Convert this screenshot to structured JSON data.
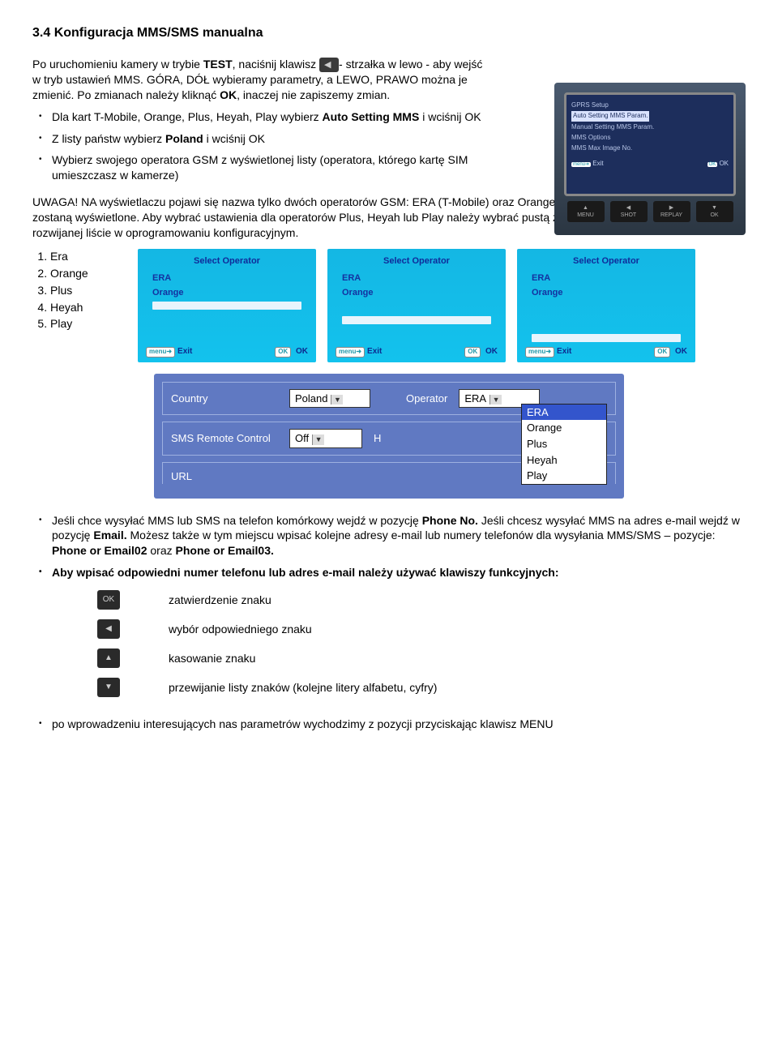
{
  "heading": "3.4 Konfiguracja MMS/SMS manualna",
  "para1_a": "Po uruchomieniu kamery w trybie ",
  "para1_test": "TEST",
  "para1_b": ", naciśnij klawisz ",
  "para1_c": "- strzałka w lewo - aby wejść w tryb ustawień MMS. GÓRA, DÓŁ wybieramy parametry, a LEWO, PRAWO można je zmienić. Po zmianach należy kliknąć ",
  "para1_ok": "OK",
  "para1_d": ", inaczej nie zapiszemy zmian.",
  "bullets1": {
    "b1a": "Dla kart T-Mobile, Orange, Plus, Heyah, Play wybierz ",
    "b1b": "Auto Setting MMS",
    "b1c": " i wciśnij OK",
    "b2a": "Z listy państw wybierz ",
    "b2b": "Poland",
    "b2c": " i wciśnij OK",
    "b3": "Wybierz swojego operatora GSM z wyświetlonej listy (operatora, którego kartę SIM umieszczasz w kamerze)"
  },
  "device": {
    "l1": "GPRS Setup",
    "l2": "Auto Setting MMS Param.",
    "l3": "Manual Setting MMS Param.",
    "l4": "MMS Options",
    "l5": "MMS Max Image No.",
    "exit_badge": "menu➜",
    "exit": "Exit",
    "ok_badge": "OK",
    "ok": "OK",
    "btn1": "MENU",
    "btn2": "SHOT",
    "btn3": "REPLAY",
    "btn4": "OK"
  },
  "uwaga": "UWAGA! NA wyświetlaczu pojawi się nazwa tylko dwóch operatorów GSM: ERA (T-Mobile) oraz Orange, nazwy kolejnych 3 operatorów nie zostaną wyświetlone. Aby wybrać ustawienia dla operatorów Plus, Heyah lub Play należy wybrać pustą zakładkę w kolejności takiej jak w rozwijanej liście w oprogramowaniu konfiguracyjnym.",
  "oplist": {
    "o1": "Era",
    "o2": "Orange",
    "o3": "Plus",
    "o4": "Heyah",
    "o5": "Play"
  },
  "opshot": {
    "title": "Select Operator",
    "opt1": "ERA",
    "opt2": "Orange",
    "menu_badge": "menu➜",
    "exit": "Exit",
    "ok_badge": "OK",
    "ok": "OK"
  },
  "cfg": {
    "country_lbl": "Country",
    "country_val": "Poland",
    "operator_lbl": "Operator",
    "operator_val": "ERA",
    "sms_lbl": "SMS Remote Control",
    "sms_val": "Off",
    "sms_h": "H",
    "url_lbl": "URL",
    "dd1": "ERA",
    "dd2": "Orange",
    "dd3": "Plus",
    "dd4": "Heyah",
    "dd5": "Play"
  },
  "bullets2": {
    "b1a": "Jeśli chce wysyłać MMS lub SMS na telefon komórkowy wejdź w pozycję ",
    "b1b": "Phone No.",
    "b1c": " Jeśli chcesz wysyłać MMS na adres e-mail wejdź w pozycję ",
    "b1d": "Email.",
    "b1e": " Możesz także w tym miejscu wpisać kolejne adresy e-mail lub numery telefonów dla wysyłania MMS/SMS – pozycje: ",
    "b1f": "Phone or Email02",
    "b1g": " oraz ",
    "b1h": "Phone or Email03.",
    "b2": "Aby wpisać odpowiedni numer telefonu lub adres e-mail należy używać klawiszy funkcyjnych:"
  },
  "keys": {
    "k1": "zatwierdzenie znaku",
    "k2": "wybór odpowiedniego znaku",
    "k3": "kasowanie znaku",
    "k4": "przewijanie listy znaków (kolejne litery alfabetu, cyfry)"
  },
  "last": "po wprowadzeniu interesujących nas parametrów wychodzimy z pozycji przyciskając klawisz MENU",
  "icons": {
    "ok": "OK",
    "left": "◀",
    "up": "▲",
    "down": "▼"
  }
}
